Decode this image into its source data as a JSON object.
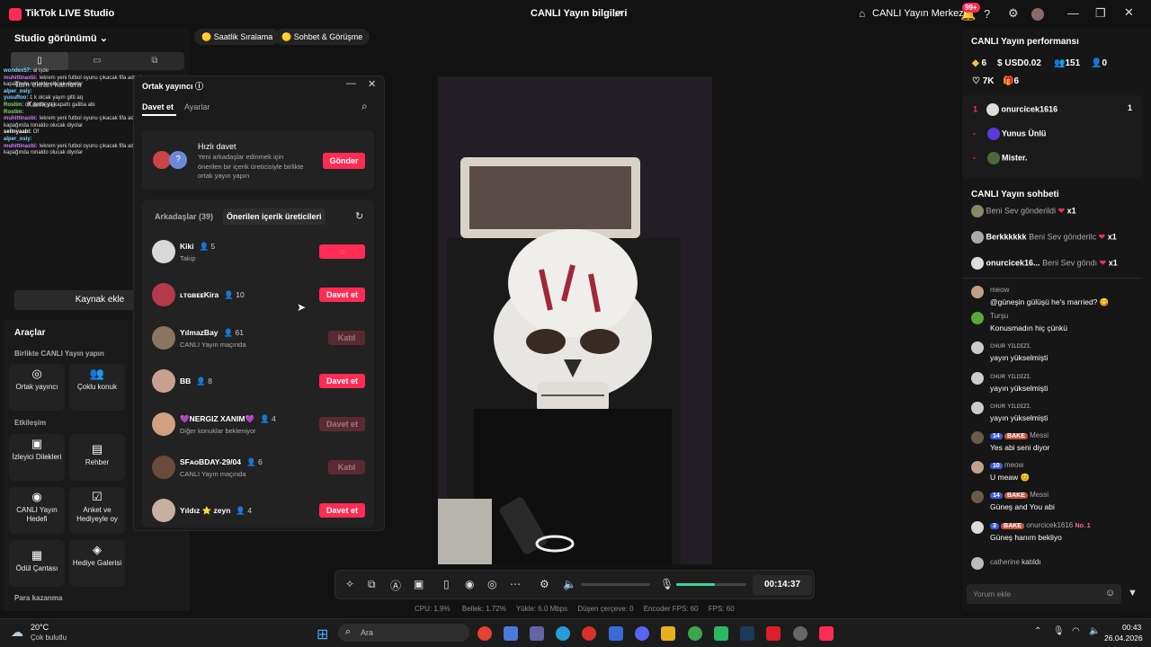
{
  "app": {
    "title": "TikTok LIVE Studio",
    "center_title": "CANLI Yayın bilgileri",
    "live_center": "CANLI Yayın Merkezi",
    "notif_badge": "99+"
  },
  "left": {
    "studio_view": "Studio görünümü",
    "full_screen": "Tam ekran kamera",
    "camera": "Kamera",
    "add_source": "Kaynak ekle",
    "tools_title": "Araçlar",
    "section_live_together": "Birlikte CANLI Yayın yapın",
    "section_interaction": "Etkileşim",
    "section_earn": "Para kazanma",
    "tools": [
      {
        "label": "Ortak yayıncı",
        "icon": "co-host-icon"
      },
      {
        "label": "Çoklu konuk",
        "icon": "multi-guest-icon"
      },
      {
        "label": "İzleyici Dilekleri",
        "icon": "viewer-wishes-icon"
      },
      {
        "label": "Rehber",
        "icon": "guide-icon"
      },
      {
        "label": "CANLI Yayın Hedefi",
        "icon": "live-goal-icon"
      },
      {
        "label": "Anket ve Hediyeyle oy",
        "icon": "poll-icon"
      },
      {
        "label": "Ödül Çantası",
        "icon": "reward-bag-icon"
      },
      {
        "label": "Hediye Galerisi",
        "icon": "gift-gallery-icon"
      }
    ],
    "chat_log": [
      {
        "user": "wondex57:",
        "text": "al işde"
      },
      {
        "user": "muhittinaxbi:",
        "text": "!ekrem yeni futbol oyunu çıkacak fifa adında kapağında ronaldo olucak diyolar"
      },
      {
        "user": "alper_osiy:",
        "text": ""
      },
      {
        "user": "yusuffoo:",
        "text": "1 k olcak yayın gitti aq"
      },
      {
        "user": "Rostim:",
        "text": "off dedik ya kapattı galiba abi"
      },
      {
        "user": "Rostim:",
        "text": ""
      },
      {
        "user": "muhittinaxbi:",
        "text": "!ekrem yeni futbol oyunu çıkacak fifa adında kapağında ronaldo olucak diyolar"
      },
      {
        "user": "sellnyaabi:",
        "text": "Of"
      },
      {
        "user": "alper_osiy:",
        "text": ""
      },
      {
        "user": "muhittinaxbi:",
        "text": "!ekrem yeni futbol oyunu çıkacak fifa adında kapağında ronaldo olucak diyolar"
      }
    ]
  },
  "chips": [
    {
      "label": "Saatlik Sıralama"
    },
    {
      "label": "Sohbet & Görüşme"
    }
  ],
  "modal": {
    "title": "Ortak yayıncı",
    "tab_invite": "Davet et",
    "tab_settings": "Ayarlar",
    "quick_title": "Hızlı davet",
    "quick_desc": "Yeni arkadaşlar edinmek için önerilen bir içerik üreticisiyle birlikte ortak yayın yapın",
    "send": "Gönder",
    "friends_tab": "Arkadaşlar (39)",
    "suggested_tab": "Önerilen içerik üreticileri",
    "rows": [
      {
        "name": "Kiki",
        "count": "5",
        "sub": "Takip",
        "btn": "",
        "state": "loading"
      },
      {
        "name": "ʟᴛɢʙᴇᴇKira",
        "count": "10",
        "sub": "",
        "btn": "Davet et",
        "state": "active"
      },
      {
        "name": "YılmazBay",
        "count": "61",
        "sub": "CANLI Yayın maçında",
        "btn": "Katıl",
        "state": "dim"
      },
      {
        "name": "BB",
        "count": "8",
        "sub": "",
        "btn": "Davet et",
        "state": "active"
      },
      {
        "name": "💜NERGIZ XANIM💜",
        "count": "4",
        "sub": "Diğer konuklar bekleniyor",
        "btn": "Davet et",
        "state": "dim"
      },
      {
        "name": "SFᴀᴏBDAY-29/04",
        "count": "6",
        "sub": "CANLI Yayın maçında",
        "btn": "Katıl",
        "state": "dim"
      },
      {
        "name": "Yıldız ⭐ zeyn",
        "count": "4",
        "sub": "",
        "btn": "Davet et",
        "state": "active"
      }
    ]
  },
  "controls": {
    "timer": "00:14:37",
    "mic_level": 0.55,
    "volume_level": 0
  },
  "stats": {
    "cpu": "CPU: 1.9%",
    "memory": "Bellek: 1.72%",
    "load": "Yükle: 6.0 Mbps",
    "dropped": "Düşen çerçeve: 0",
    "encoder_fps": "Encoder FPS: 60",
    "fps": "FPS: 60"
  },
  "right": {
    "perf_title": "CANLI Yayın performansı",
    "diamonds": "6",
    "usd": "USD0.02",
    "viewers": "151",
    "new_followers": "0",
    "likes": "7K",
    "gifts": "6",
    "ranking": [
      {
        "rank": "1",
        "name": "onurcicek1616",
        "score": "1"
      },
      {
        "rank": "-",
        "name": "Yunus Ünlü",
        "score": ""
      },
      {
        "rank": "-",
        "name": "Mister.",
        "score": ""
      }
    ],
    "chat_title": "CANLI Yayın sohbeti",
    "gifts_list": [
      {
        "user": "",
        "text": "Beni Sev gönderildi",
        "mult": "x1"
      },
      {
        "user": "Berkkkkkk",
        "text": "Beni Sev gönderilc",
        "mult": "x1"
      },
      {
        "user": "onurcicek16...",
        "text": "Beni Sev göndı",
        "mult": "x1"
      }
    ],
    "messages": [
      {
        "level": "",
        "team": "",
        "user": "meow",
        "text": "@güneşin gülüşü he's married? 😋"
      },
      {
        "level": "",
        "team": "",
        "user": "Turşu",
        "text": "Konusmadın hiç çünkü"
      },
      {
        "level": "",
        "team": "",
        "user": "ᴄʜᴜʀ ʏɪʟᴅɪᴢɪ.",
        "text": "yayın yükselmişti"
      },
      {
        "level": "",
        "team": "",
        "user": "ᴄʜᴜʀ ʏɪʟᴅɪᴢɪ.",
        "text": "yayın yükselmişti"
      },
      {
        "level": "",
        "team": "",
        "user": "ᴄʜᴜʀ ʏɪʟᴅɪᴢɪ.",
        "text": "yayın yükselmişti"
      },
      {
        "level": "14",
        "team": "BAKE",
        "user": "Messi",
        "text": "Yes abi seni diyor"
      },
      {
        "level": "10",
        "team": "",
        "user": "meow",
        "text": "U meaw 😊"
      },
      {
        "level": "14",
        "team": "BAKE",
        "user": "Messi",
        "text": "Güneş and You abi"
      },
      {
        "level": "3",
        "team": "BAKE",
        "user": "onurcicek1616",
        "text": "Güneş hanım bekliyo",
        "badge": "No. 1"
      }
    ],
    "joined": {
      "user": "catherine",
      "text": "katıldı"
    },
    "comment_placeholder": "Yorum ekle"
  },
  "taskbar": {
    "temp": "20°C",
    "weather": "Çok bulutlu",
    "search": "Ara",
    "time": "00:43",
    "date": "26.04.2026"
  }
}
